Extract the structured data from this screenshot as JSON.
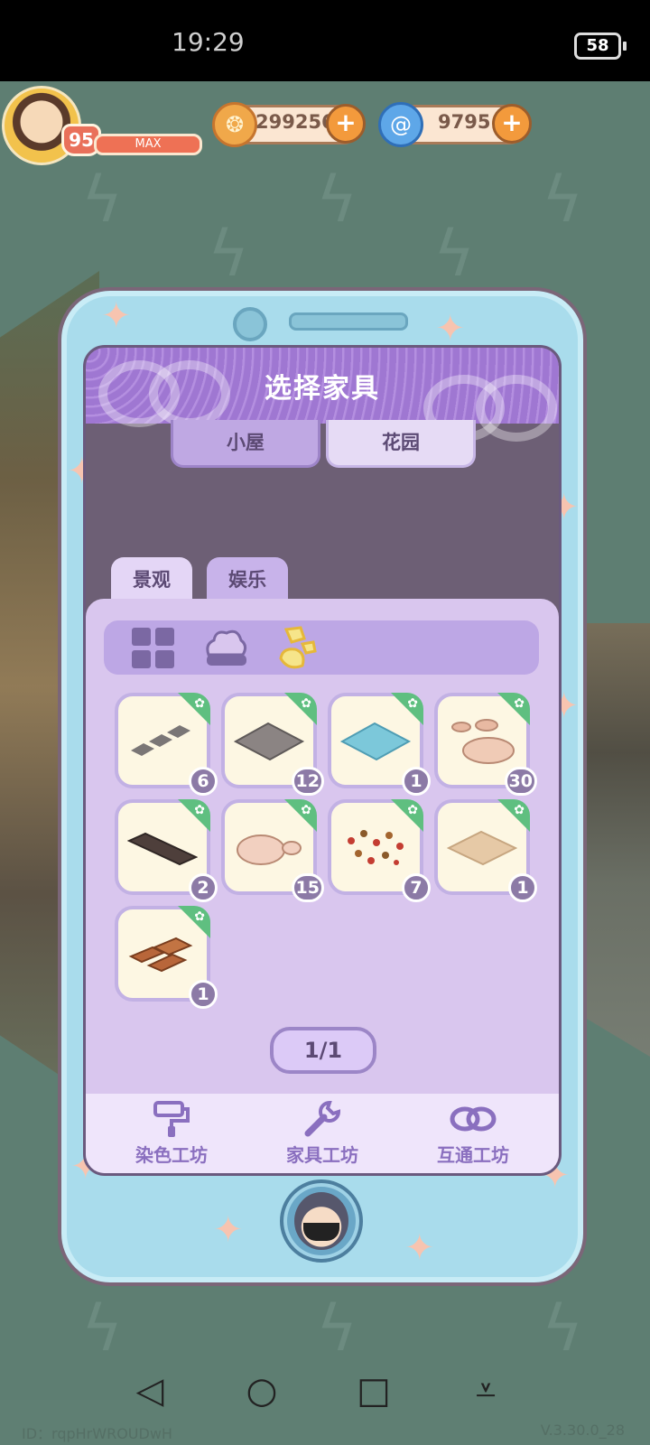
{
  "status_bar": {
    "time": "19:29",
    "battery": "58"
  },
  "player": {
    "level": "95",
    "exp_label": "MAX"
  },
  "currencies": [
    {
      "icon": "coin-icon",
      "value": "2992566"
    },
    {
      "icon": "swirl-gem-icon",
      "value": "9795"
    }
  ],
  "dialog": {
    "title": "选择家具",
    "top_tabs": [
      {
        "label": "小屋",
        "active": true
      },
      {
        "label": "花园",
        "active": false
      }
    ],
    "sub_tabs": [
      {
        "label": "景观",
        "active": true
      },
      {
        "label": "娱乐",
        "active": false
      }
    ],
    "filters": [
      {
        "icon": "grid-icon",
        "active": false
      },
      {
        "icon": "bush-icon",
        "active": false
      },
      {
        "icon": "stones-icon",
        "active": true
      }
    ],
    "items": [
      {
        "name": "stepping-slabs",
        "count": "6"
      },
      {
        "name": "gray-stone-tile",
        "count": "12"
      },
      {
        "name": "water-tile",
        "count": "1"
      },
      {
        "name": "pebble-path",
        "count": "30"
      },
      {
        "name": "dark-wood-plank",
        "count": "2"
      },
      {
        "name": "beige-rocks",
        "count": "15"
      },
      {
        "name": "fallen-leaves",
        "count": "7"
      },
      {
        "name": "sand-tile",
        "count": "1"
      },
      {
        "name": "wood-boards",
        "count": "1"
      }
    ],
    "page": "1/1",
    "workshops": [
      {
        "icon": "paint-roller-icon",
        "label": "染色工坊"
      },
      {
        "icon": "wrench-icon",
        "label": "家具工坊"
      },
      {
        "icon": "link-icon",
        "label": "互通工坊"
      }
    ]
  },
  "footer": {
    "id": "ID：rqpHrWROUDwH",
    "version": "V.3.30.0_28"
  },
  "colors": {
    "accent": "#9f77d2",
    "panel": "#d9c6ee",
    "frame": "#a9dcec",
    "badge": "#8c7aa6"
  }
}
